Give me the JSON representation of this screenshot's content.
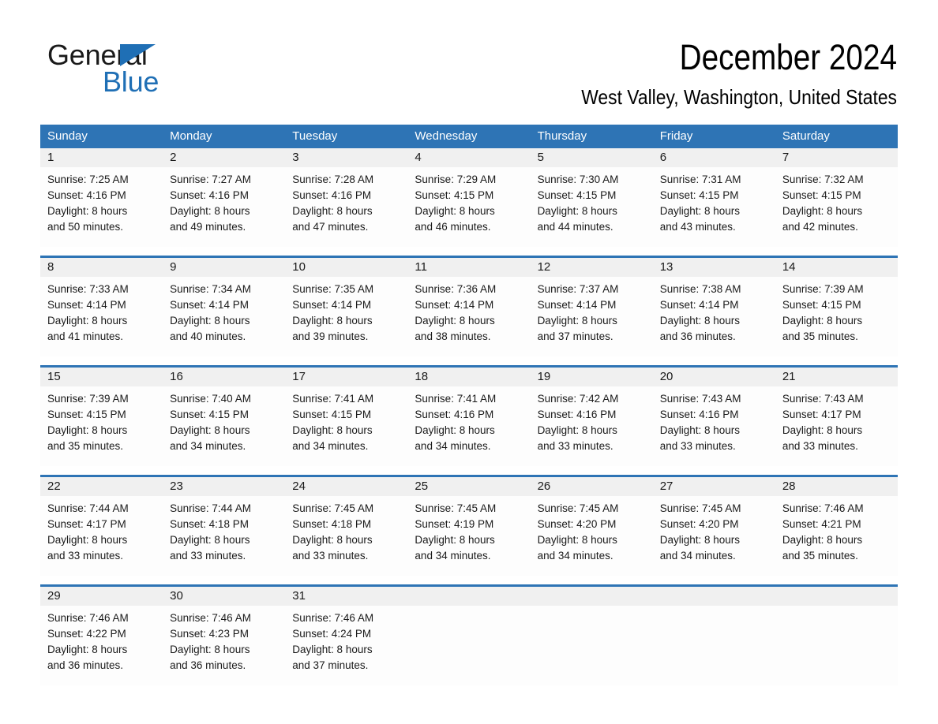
{
  "brand": {
    "name_part1": "General",
    "name_part2": "Blue",
    "accent_color": "#1f6fb5",
    "triangle_icon": "triangle-icon"
  },
  "header": {
    "title": "December 2024",
    "subtitle": "West Valley, Washington, United States"
  },
  "calendar": {
    "header_bg": "#2e74b5",
    "header_text_color": "#ffffff",
    "daynum_bg": "#f0f0f0",
    "weekdays": [
      "Sunday",
      "Monday",
      "Tuesday",
      "Wednesday",
      "Thursday",
      "Friday",
      "Saturday"
    ],
    "weeks": [
      [
        {
          "day": "1",
          "sunrise": "Sunrise: 7:25 AM",
          "sunset": "Sunset: 4:16 PM",
          "daylight_line1": "Daylight: 8 hours",
          "daylight_line2": "and 50 minutes."
        },
        {
          "day": "2",
          "sunrise": "Sunrise: 7:27 AM",
          "sunset": "Sunset: 4:16 PM",
          "daylight_line1": "Daylight: 8 hours",
          "daylight_line2": "and 49 minutes."
        },
        {
          "day": "3",
          "sunrise": "Sunrise: 7:28 AM",
          "sunset": "Sunset: 4:16 PM",
          "daylight_line1": "Daylight: 8 hours",
          "daylight_line2": "and 47 minutes."
        },
        {
          "day": "4",
          "sunrise": "Sunrise: 7:29 AM",
          "sunset": "Sunset: 4:15 PM",
          "daylight_line1": "Daylight: 8 hours",
          "daylight_line2": "and 46 minutes."
        },
        {
          "day": "5",
          "sunrise": "Sunrise: 7:30 AM",
          "sunset": "Sunset: 4:15 PM",
          "daylight_line1": "Daylight: 8 hours",
          "daylight_line2": "and 44 minutes."
        },
        {
          "day": "6",
          "sunrise": "Sunrise: 7:31 AM",
          "sunset": "Sunset: 4:15 PM",
          "daylight_line1": "Daylight: 8 hours",
          "daylight_line2": "and 43 minutes."
        },
        {
          "day": "7",
          "sunrise": "Sunrise: 7:32 AM",
          "sunset": "Sunset: 4:15 PM",
          "daylight_line1": "Daylight: 8 hours",
          "daylight_line2": "and 42 minutes."
        }
      ],
      [
        {
          "day": "8",
          "sunrise": "Sunrise: 7:33 AM",
          "sunset": "Sunset: 4:14 PM",
          "daylight_line1": "Daylight: 8 hours",
          "daylight_line2": "and 41 minutes."
        },
        {
          "day": "9",
          "sunrise": "Sunrise: 7:34 AM",
          "sunset": "Sunset: 4:14 PM",
          "daylight_line1": "Daylight: 8 hours",
          "daylight_line2": "and 40 minutes."
        },
        {
          "day": "10",
          "sunrise": "Sunrise: 7:35 AM",
          "sunset": "Sunset: 4:14 PM",
          "daylight_line1": "Daylight: 8 hours",
          "daylight_line2": "and 39 minutes."
        },
        {
          "day": "11",
          "sunrise": "Sunrise: 7:36 AM",
          "sunset": "Sunset: 4:14 PM",
          "daylight_line1": "Daylight: 8 hours",
          "daylight_line2": "and 38 minutes."
        },
        {
          "day": "12",
          "sunrise": "Sunrise: 7:37 AM",
          "sunset": "Sunset: 4:14 PM",
          "daylight_line1": "Daylight: 8 hours",
          "daylight_line2": "and 37 minutes."
        },
        {
          "day": "13",
          "sunrise": "Sunrise: 7:38 AM",
          "sunset": "Sunset: 4:14 PM",
          "daylight_line1": "Daylight: 8 hours",
          "daylight_line2": "and 36 minutes."
        },
        {
          "day": "14",
          "sunrise": "Sunrise: 7:39 AM",
          "sunset": "Sunset: 4:15 PM",
          "daylight_line1": "Daylight: 8 hours",
          "daylight_line2": "and 35 minutes."
        }
      ],
      [
        {
          "day": "15",
          "sunrise": "Sunrise: 7:39 AM",
          "sunset": "Sunset: 4:15 PM",
          "daylight_line1": "Daylight: 8 hours",
          "daylight_line2": "and 35 minutes."
        },
        {
          "day": "16",
          "sunrise": "Sunrise: 7:40 AM",
          "sunset": "Sunset: 4:15 PM",
          "daylight_line1": "Daylight: 8 hours",
          "daylight_line2": "and 34 minutes."
        },
        {
          "day": "17",
          "sunrise": "Sunrise: 7:41 AM",
          "sunset": "Sunset: 4:15 PM",
          "daylight_line1": "Daylight: 8 hours",
          "daylight_line2": "and 34 minutes."
        },
        {
          "day": "18",
          "sunrise": "Sunrise: 7:41 AM",
          "sunset": "Sunset: 4:16 PM",
          "daylight_line1": "Daylight: 8 hours",
          "daylight_line2": "and 34 minutes."
        },
        {
          "day": "19",
          "sunrise": "Sunrise: 7:42 AM",
          "sunset": "Sunset: 4:16 PM",
          "daylight_line1": "Daylight: 8 hours",
          "daylight_line2": "and 33 minutes."
        },
        {
          "day": "20",
          "sunrise": "Sunrise: 7:43 AM",
          "sunset": "Sunset: 4:16 PM",
          "daylight_line1": "Daylight: 8 hours",
          "daylight_line2": "and 33 minutes."
        },
        {
          "day": "21",
          "sunrise": "Sunrise: 7:43 AM",
          "sunset": "Sunset: 4:17 PM",
          "daylight_line1": "Daylight: 8 hours",
          "daylight_line2": "and 33 minutes."
        }
      ],
      [
        {
          "day": "22",
          "sunrise": "Sunrise: 7:44 AM",
          "sunset": "Sunset: 4:17 PM",
          "daylight_line1": "Daylight: 8 hours",
          "daylight_line2": "and 33 minutes."
        },
        {
          "day": "23",
          "sunrise": "Sunrise: 7:44 AM",
          "sunset": "Sunset: 4:18 PM",
          "daylight_line1": "Daylight: 8 hours",
          "daylight_line2": "and 33 minutes."
        },
        {
          "day": "24",
          "sunrise": "Sunrise: 7:45 AM",
          "sunset": "Sunset: 4:18 PM",
          "daylight_line1": "Daylight: 8 hours",
          "daylight_line2": "and 33 minutes."
        },
        {
          "day": "25",
          "sunrise": "Sunrise: 7:45 AM",
          "sunset": "Sunset: 4:19 PM",
          "daylight_line1": "Daylight: 8 hours",
          "daylight_line2": "and 34 minutes."
        },
        {
          "day": "26",
          "sunrise": "Sunrise: 7:45 AM",
          "sunset": "Sunset: 4:20 PM",
          "daylight_line1": "Daylight: 8 hours",
          "daylight_line2": "and 34 minutes."
        },
        {
          "day": "27",
          "sunrise": "Sunrise: 7:45 AM",
          "sunset": "Sunset: 4:20 PM",
          "daylight_line1": "Daylight: 8 hours",
          "daylight_line2": "and 34 minutes."
        },
        {
          "day": "28",
          "sunrise": "Sunrise: 7:46 AM",
          "sunset": "Sunset: 4:21 PM",
          "daylight_line1": "Daylight: 8 hours",
          "daylight_line2": "and 35 minutes."
        }
      ],
      [
        {
          "day": "29",
          "sunrise": "Sunrise: 7:46 AM",
          "sunset": "Sunset: 4:22 PM",
          "daylight_line1": "Daylight: 8 hours",
          "daylight_line2": "and 36 minutes."
        },
        {
          "day": "30",
          "sunrise": "Sunrise: 7:46 AM",
          "sunset": "Sunset: 4:23 PM",
          "daylight_line1": "Daylight: 8 hours",
          "daylight_line2": "and 36 minutes."
        },
        {
          "day": "31",
          "sunrise": "Sunrise: 7:46 AM",
          "sunset": "Sunset: 4:24 PM",
          "daylight_line1": "Daylight: 8 hours",
          "daylight_line2": "and 37 minutes."
        },
        {
          "day": "",
          "sunrise": "",
          "sunset": "",
          "daylight_line1": "",
          "daylight_line2": ""
        },
        {
          "day": "",
          "sunrise": "",
          "sunset": "",
          "daylight_line1": "",
          "daylight_line2": ""
        },
        {
          "day": "",
          "sunrise": "",
          "sunset": "",
          "daylight_line1": "",
          "daylight_line2": ""
        },
        {
          "day": "",
          "sunrise": "",
          "sunset": "",
          "daylight_line1": "",
          "daylight_line2": ""
        }
      ]
    ]
  }
}
